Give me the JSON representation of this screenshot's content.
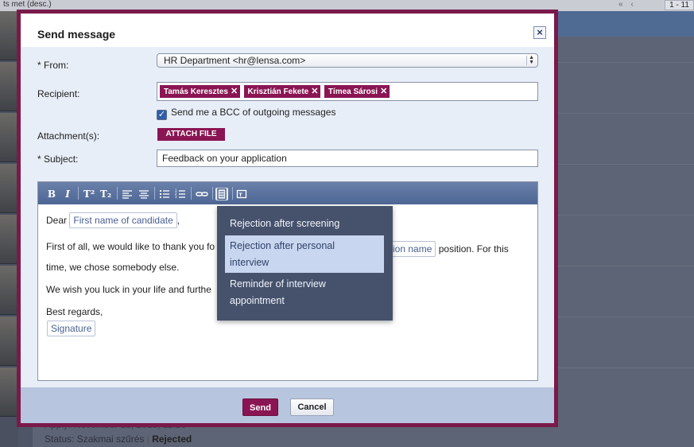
{
  "background": {
    "sort_label": "ts met (desc.)",
    "pager": "1 - 11",
    "apply_text": "Apply: November 13, 2013, 11:16",
    "status_label": "Status: Szakmai szűrés",
    "status_value": "Rejected"
  },
  "modal": {
    "title": "Send message",
    "from_label": "* From:",
    "from_value": "HR Department <hr@lensa.com>",
    "recipient_label": "Recipient:",
    "recipients": [
      "Tamás Keresztes",
      "Krisztián Fekete",
      "Tímea Sárosi"
    ],
    "bcc_label": "Send me a BCC of outgoing messages",
    "bcc_checked": true,
    "attachment_label": "Attachment(s):",
    "attach_button": "ATTACH FILE",
    "subject_label": "* Subject:",
    "subject_value": "Feedback on your application",
    "icons": {
      "bold": "B",
      "italic": "I",
      "superscript": "T²",
      "subscript": "T₂",
      "align_left": "align-left-icon",
      "align_center": "align-center-icon",
      "bullet_list": "bullet-list-icon",
      "numbered_list": "numbered-list-icon",
      "link": "link-icon",
      "template": "template-icon",
      "placeholder": "placeholder-icon"
    },
    "body": {
      "dear": "Dear",
      "first_name_placeholder": "First name of candidate",
      "comma": ",",
      "line2_start": "First of all, we would like to thank you fo",
      "position_placeholder": "sition name",
      "line2_end": "position. For this",
      "line3": "time, we chose somebody else.",
      "line4": "We wish you luck in your life and furthe",
      "best_regards": "Best regards,",
      "signature_placeholder": "Signature"
    },
    "template_menu": [
      "Rejection after screening",
      "Rejection after personal",
      "interview",
      "Reminder of interview",
      "appointment"
    ],
    "send_button": "Send",
    "cancel_button": "Cancel",
    "close_icon": "close-icon"
  }
}
